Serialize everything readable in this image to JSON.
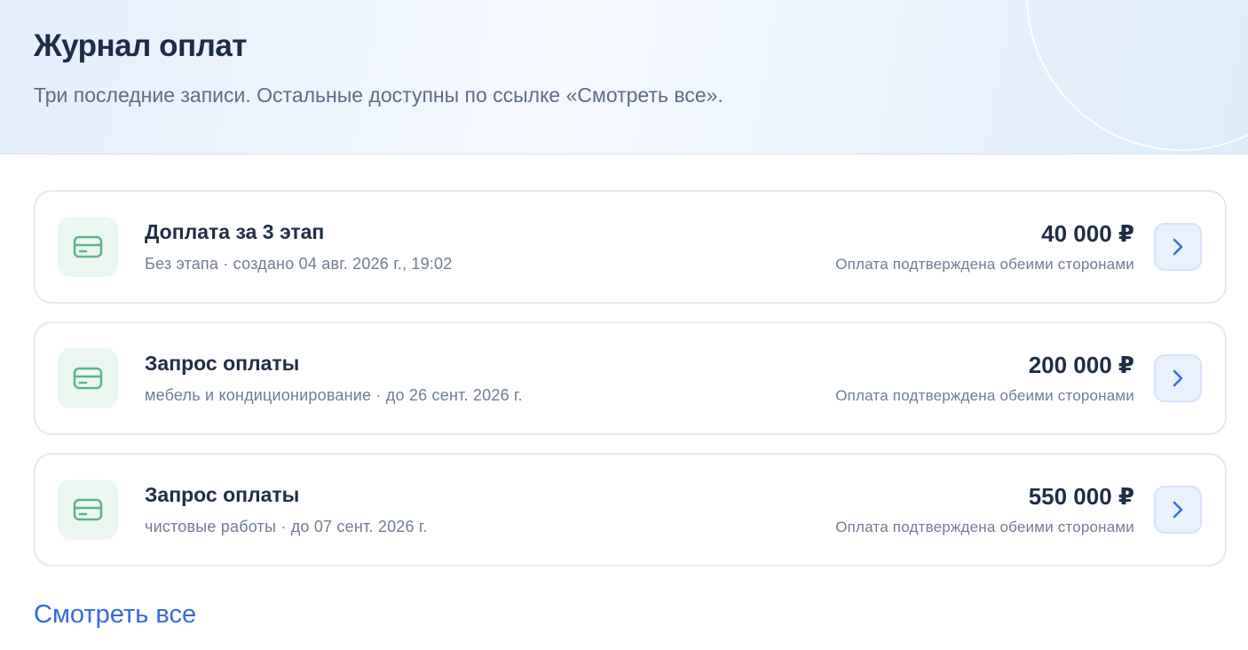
{
  "header": {
    "title": "Журнал оплат",
    "subtitle": "Три последние записи. Остальные доступны по ссылке «Смотреть все»."
  },
  "payments": [
    {
      "title": "Доплата за 3 этап",
      "meta": "Без этапа · создано 04 авг. 2026 г., 19:02",
      "amount": "40 000 ₽",
      "status": "Оплата подтверждена обеими сторонами",
      "icon": "credit-card-icon"
    },
    {
      "title": "Запрос оплаты",
      "meta": "мебель и кондиционирование · до 26 сент. 2026 г.",
      "amount": "200 000 ₽",
      "status": "Оплата подтверждена обеими сторонами",
      "icon": "credit-card-icon"
    },
    {
      "title": "Запрос оплаты",
      "meta": "чистовые работы · до 07 сент. 2026 г.",
      "amount": "550 000 ₽",
      "status": "Оплата подтверждена обеими сторонами",
      "icon": "credit-card-icon"
    }
  ],
  "footer": {
    "view_all": "Смотреть все"
  },
  "colors": {
    "accent": "#3369e3",
    "card_icon": "#5bb58a",
    "card_icon_bg": "#edf7f2",
    "arrow": "#3a6fd8"
  }
}
